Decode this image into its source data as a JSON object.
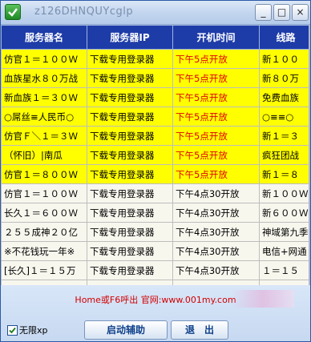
{
  "window": {
    "title": "z126DHNQUYcglp"
  },
  "controls": {
    "minimize": "_",
    "maximize": "□",
    "close": "×"
  },
  "table": {
    "headers": [
      "服务器名",
      "服务器IP",
      "开机时间",
      "线路"
    ],
    "rows": [
      {
        "name": "仿官１＝１００Ｗ",
        "ip": "下载专用登录器",
        "time": "下午5点开放",
        "line": "新１００",
        "highlight": true
      },
      {
        "name": "血族星水８０万战",
        "ip": "下载专用登录器",
        "time": "下午5点开放",
        "line": "新８０万",
        "highlight": true
      },
      {
        "name": "新血族１＝３０Ｗ",
        "ip": "下载专用登录器",
        "time": "下午5点开放",
        "line": "免费血族",
        "highlight": true
      },
      {
        "name": "○屌丝≡人民币○",
        "ip": "下载专用登录器",
        "time": "下午5点开放",
        "line": "○≡≡○",
        "highlight": true
      },
      {
        "name": "仿官Ｆ＼１＝３Ｗ",
        "ip": "下载专用登录器",
        "time": "下午5点开放",
        "line": "新１＝３",
        "highlight": true
      },
      {
        "name": "（怀旧）|南瓜",
        "ip": "下载专用登录器",
        "time": "下午5点开放",
        "line": "疯狂团战",
        "highlight": true
      },
      {
        "name": "仿官１＝８００Ｗ",
        "ip": "下载专用登录器",
        "time": "下午5点开放",
        "line": "新１＝８",
        "highlight": true
      },
      {
        "name": "仿官１＝１００Ｗ",
        "ip": "下载专用登录器",
        "time": "下午4点30开放",
        "line": "新１００Ｗ",
        "highlight": false
      },
      {
        "name": "长久１＝６００Ｗ",
        "ip": "下载专用登录器",
        "time": "下午4点30开放",
        "line": "新６００Ｗ",
        "highlight": false
      },
      {
        "name": "２５５成神２０亿",
        "ip": "下载专用登录器",
        "time": "下午4点30开放",
        "line": "神域第九季",
        "highlight": false
      },
      {
        "name": "※不花钱玩一年※",
        "ip": "下载专用登录器",
        "time": "下午4点30开放",
        "line": "电信+网通",
        "highlight": false
      },
      {
        "name": "[长久]１＝１５万",
        "ip": "下载专用登录器",
        "time": "下午4点30开放",
        "line": "１＝１５",
        "highlight": false
      },
      {
        "name": "",
        "ip": "",
        "time": "",
        "line": "",
        "highlight": false
      }
    ]
  },
  "footer": {
    "hint": "Home或F6呼出 官网:www.001my.com",
    "checkbox_label": "无限xp",
    "checkbox_checked": true,
    "start_button": "启动辅助",
    "exit_button": "退　出"
  },
  "colors": {
    "header_bg": "#1e3ca8",
    "highlight_row": "#ffff00",
    "red_text": "#e00000"
  }
}
